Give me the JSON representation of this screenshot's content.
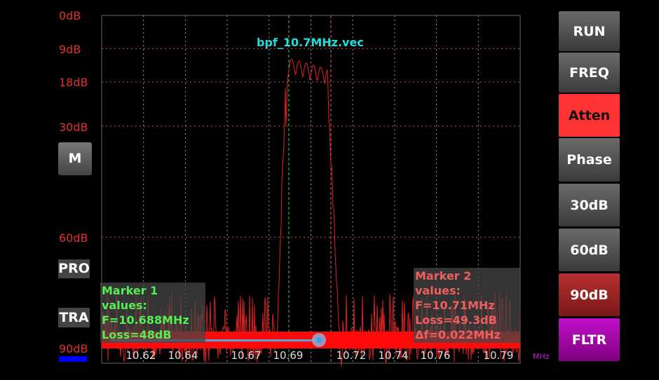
{
  "trace_title": "bpf_10.7MHz.vec",
  "y_axis": {
    "labels": [
      "0dB",
      "9dB",
      "18dB",
      "30dB",
      "60dB",
      "90dB"
    ],
    "values": [
      0,
      9,
      18,
      30,
      60,
      90
    ]
  },
  "x_axis": {
    "unit": "MHz",
    "ticks": [
      "10.62",
      "10.64",
      "10.67",
      "10.69",
      "10.72",
      "10.74",
      "10.76",
      "10.79"
    ],
    "tick_values": [
      10.62,
      10.64,
      10.67,
      10.69,
      10.72,
      10.74,
      10.76,
      10.79
    ]
  },
  "left_buttons": {
    "m": "M",
    "pro": "PRO",
    "tra": "TRA"
  },
  "right_buttons": [
    {
      "label": "RUN",
      "color": "#555555"
    },
    {
      "label": "FREQ",
      "color": "#555555"
    },
    {
      "label": "Atten",
      "color": "#ff3333",
      "active": true
    },
    {
      "label": "Phase",
      "color": "#555555"
    },
    {
      "label": "30dB",
      "color": "#555555"
    },
    {
      "label": "60dB",
      "color": "#555555"
    },
    {
      "label": "90dB",
      "color": "#aa2222"
    },
    {
      "label": "FLTR",
      "color": "#aa00aa"
    }
  ],
  "marker1": {
    "title": "Marker 1 values:",
    "freq": "F=10.688MHz",
    "loss": "Loss=48dB",
    "freq_value": 10.688,
    "color": "#55ee55"
  },
  "marker2": {
    "title": "Marker 2 values:",
    "freq": "F=10.71MHz",
    "loss": "Loss=49.3dB",
    "delta": "Δf=0.022MHz",
    "freq_value": 10.71,
    "color": "#ee6060"
  },
  "slider": {
    "value_percent": 52
  },
  "colors": {
    "trace": "#dd2222",
    "grid": "#888888",
    "title": "#22dddd",
    "axis_label": "#e03030"
  }
}
